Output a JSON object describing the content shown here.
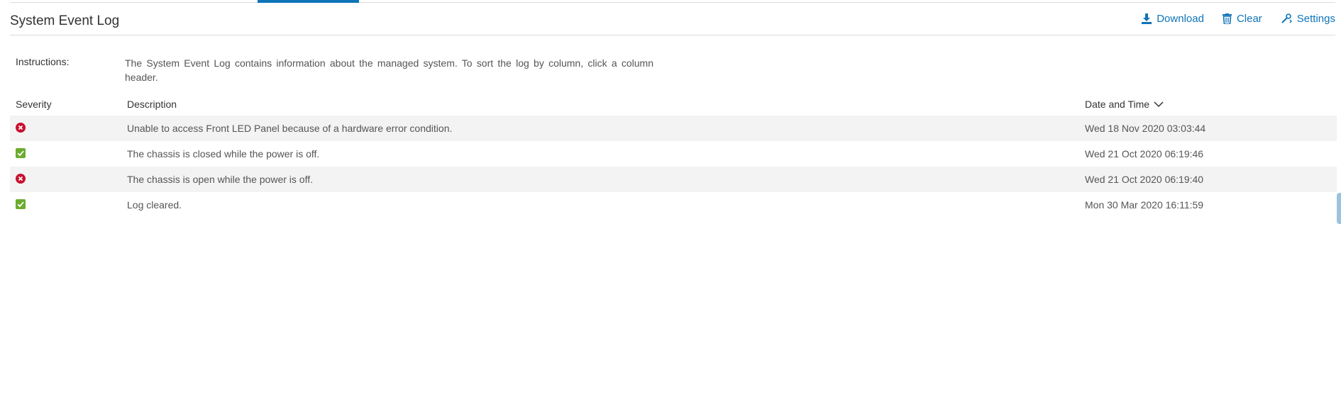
{
  "page": {
    "title": "System Event Log"
  },
  "toolbar": {
    "download_label": "Download",
    "clear_label": "Clear",
    "settings_label": "Settings"
  },
  "instructions": {
    "label": "Instructions:",
    "text": "The System Event Log contains information about the managed system. To sort the log by column, click a column header."
  },
  "table": {
    "headers": {
      "severity": "Severity",
      "description": "Description",
      "date_time": "Date and Time"
    },
    "rows": [
      {
        "severity": "critical",
        "description": "Unable to access Front LED Panel because of a hardware error condition.",
        "date_time": "Wed 18 Nov 2020 03:03:44"
      },
      {
        "severity": "ok",
        "description": "The chassis is closed while the power is off.",
        "date_time": "Wed 21 Oct 2020 06:19:46"
      },
      {
        "severity": "critical",
        "description": "The chassis is open while the power is off.",
        "date_time": "Wed 21 Oct 2020 06:19:40"
      },
      {
        "severity": "ok",
        "description": "Log cleared.",
        "date_time": "Mon 30 Mar 2020 16:11:59"
      }
    ]
  },
  "colors": {
    "accent": "#0e74b8",
    "critical": "#c8102e",
    "ok": "#6bab2e"
  },
  "icons": {
    "download": "download-icon",
    "clear": "trash-icon",
    "settings": "settings-icon",
    "sort": "chevron-down-icon"
  }
}
